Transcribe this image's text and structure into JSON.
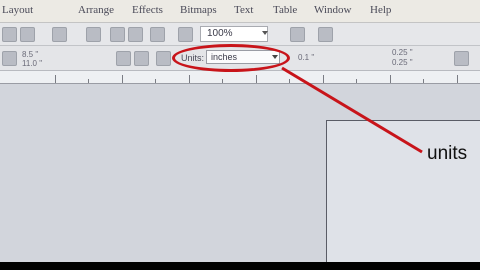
{
  "menubar": {
    "items": [
      "Layout",
      "Arrange",
      "Effects",
      "Bitmaps",
      "Text",
      "Table",
      "Window",
      "Help"
    ]
  },
  "toolbar": {
    "zoom_value": "100%"
  },
  "property_bar": {
    "width_value": "8.5 \"",
    "height_value": "11.0 \"",
    "units_label": "Units:",
    "units_value": "inches",
    "nudge_value": "0.1 \"",
    "dup_x": "0.25 \"",
    "dup_y": "0.25 \""
  },
  "annotation": {
    "label": "units",
    "color": "#c8141a"
  }
}
